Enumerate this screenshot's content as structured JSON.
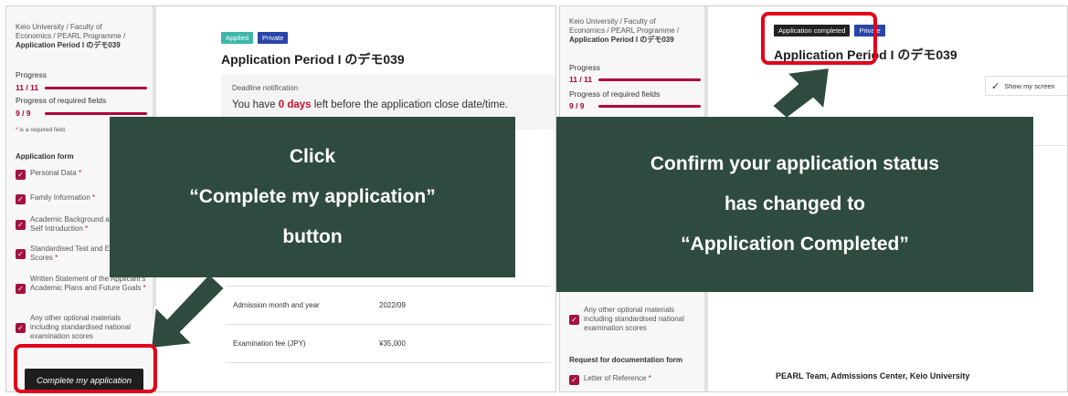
{
  "left_panel": {
    "sidebar": {
      "breadcrumb": "Keio University / Faculty of Economics / PEARL Programme / ",
      "breadcrumb_current": "Application Period I のデモ039",
      "progress_label": "Progress",
      "progress_value": "11 / 11",
      "required_label": "Progress of required fields",
      "required_value": "9 / 9",
      "required_note_star": "*",
      "required_note": " is a required field.",
      "form_heading": "Application form",
      "form_items": [
        {
          "label": "Personal Data",
          "req": "*"
        },
        {
          "label": "Family Information",
          "req": "*"
        },
        {
          "label": "Academic Background and Brief Self Introduction",
          "req": "*"
        },
        {
          "label": "Standardised Test and English Test Scores",
          "req": "*"
        },
        {
          "label": "Written Statement of the Applicant's Academic Plans and Future Goals",
          "req": "*"
        },
        {
          "label": "Any other optional materials including standardised national examination scores",
          "req": ""
        }
      ],
      "complete_button": "Complete my application"
    },
    "main": {
      "badge_applied": "Applied",
      "badge_private": "Private",
      "title": "Application Period I のデモ039",
      "deadline_heading": "Deadline notification",
      "deadline_prefix": "You have ",
      "deadline_days": "0 days",
      "deadline_suffix": " left before the application close date/time.",
      "rows": [
        {
          "key": "Admission month and year",
          "value": "2022/09"
        },
        {
          "key": "Examination fee (JPY)",
          "value": "¥35,000"
        }
      ]
    }
  },
  "right_panel": {
    "sidebar": {
      "breadcrumb": "Keio University / Faculty of Economics / PEARL Programme / ",
      "breadcrumb_current": "Application Period I のデモ039",
      "progress_label": "Progress",
      "progress_value": "11 / 11",
      "required_label": "Progress of required fields",
      "required_value": "9 / 9",
      "optional_item": "Any other optional materials including standardised national examination scores",
      "doc_heading": "Request for documentation form",
      "doc_item": "Letter of Reference",
      "doc_item_req": "*"
    },
    "main": {
      "badge_completed": "Application completed",
      "badge_private": "Private",
      "title": "Application Period I のデモ039",
      "show_screen": "Show my screen",
      "footer_team": "PEARL Team, Admissions Center, Keio University"
    }
  },
  "callouts": {
    "left": [
      "Click",
      "“Complete my application”",
      "button"
    ],
    "right": [
      "Confirm your application status",
      "has changed to",
      "“Application Completed”"
    ]
  },
  "colors": {
    "callout_bg": "#2f4b3f",
    "highlight": "#e3001b",
    "accent": "#a3133f",
    "badge_applied": "#3db8a8",
    "badge_private": "#2945a8"
  }
}
